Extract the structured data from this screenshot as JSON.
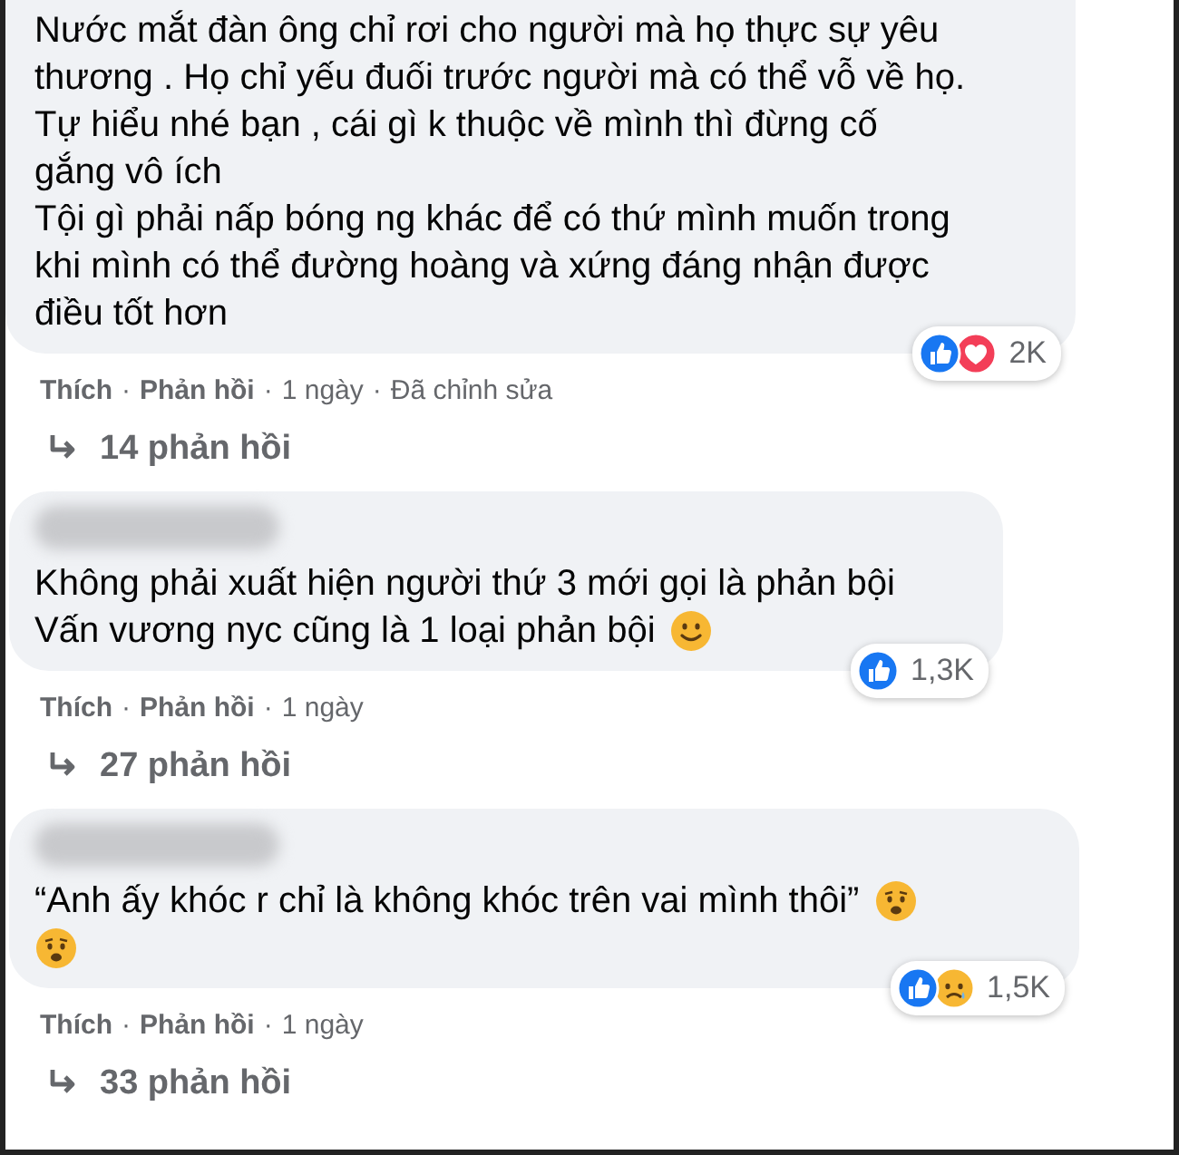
{
  "separator": "·",
  "comments": [
    {
      "lines": [
        {
          "text": "Nước mắt đàn ông chỉ rơi cho người mà họ thực sự yêu"
        },
        {
          "text": "thương . Họ chỉ yếu đuối trước người mà có thể vỗ về họ."
        },
        {
          "text": "Tự hiểu nhé bạn , cái gì k thuộc về mình thì đừng cố"
        },
        {
          "text": "gắng vô ích"
        },
        {
          "text": "Tội gì phải nấp bóng ng khác để có thứ mình muốn trong"
        },
        {
          "text": "khi mình có thể đường hoàng và xứng đáng nhận được"
        },
        {
          "text": "điều tốt hơn"
        }
      ],
      "reactions": [
        {
          "kind": "like"
        },
        {
          "kind": "love"
        }
      ],
      "reaction_count": "2K",
      "actions": [
        "Thích",
        "Phản hồi"
      ],
      "meta": [
        "1 ngày",
        "Đã chỉnh sửa"
      ],
      "replies": "14 phản hồi"
    },
    {
      "name_blurred": true,
      "lines": [
        {
          "text": "Không phải xuất hiện người thứ 3 mới gọi là phản bội"
        },
        {
          "text": "Vấn vương nyc cũng là 1 loại phản bội",
          "emojis": [
            {
              "kind": "smile"
            }
          ]
        }
      ],
      "reactions": [
        {
          "kind": "like"
        }
      ],
      "reaction_count": "1,3K",
      "actions": [
        "Thích",
        "Phản hồi"
      ],
      "meta": [
        "1 ngày"
      ],
      "replies": "27 phản hồi"
    },
    {
      "name_blurred": true,
      "lines": [
        {
          "text": "“Anh ấy khóc r chỉ là không khóc trên vai mình thôi”",
          "emojis": [
            {
              "kind": "worried"
            }
          ]
        },
        {
          "emojis": [
            {
              "kind": "worried"
            }
          ]
        }
      ],
      "reactions": [
        {
          "kind": "like"
        },
        {
          "kind": "sad"
        }
      ],
      "reaction_count": "1,5K",
      "actions": [
        "Thích",
        "Phản hồi"
      ],
      "meta": [
        "1 ngày"
      ],
      "replies": "33 phản hồi"
    }
  ]
}
